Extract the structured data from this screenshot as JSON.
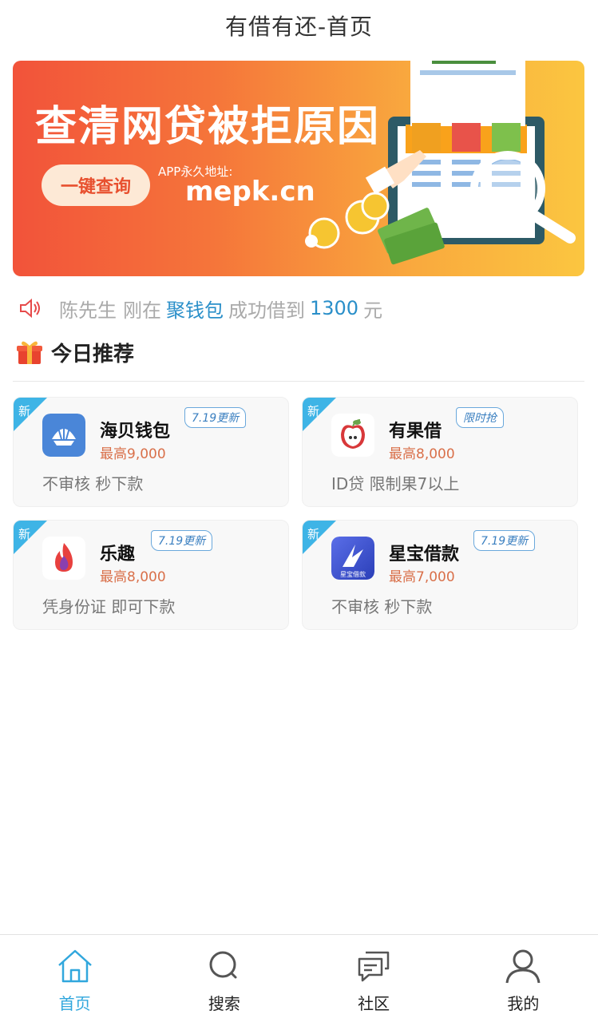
{
  "header": {
    "title": "有借有还-首页"
  },
  "banner": {
    "headline": "查清网贷被拒原因",
    "button_label": "一键查询",
    "app_label": "APP永久地址:",
    "url": "mepk.cn"
  },
  "notice": {
    "icon": "speaker-icon",
    "user": "陈先生",
    "verb": "刚在",
    "product": "聚钱包",
    "action": "成功借到",
    "amount": "1300",
    "unit": "元"
  },
  "section": {
    "icon": "gift-icon",
    "title": "今日推荐"
  },
  "cards": [
    {
      "tag": "新",
      "name": "海贝钱包",
      "badge": "7.19更新",
      "amount": "最高9,000",
      "desc": "不审核 秒下款",
      "logo": "shell-icon"
    },
    {
      "tag": "新",
      "name": "有果借",
      "badge": "限时抢",
      "amount": "最高8,000",
      "desc": "ID贷 限制果7以上",
      "logo": "apple-icon"
    },
    {
      "tag": "新",
      "name": "乐趣",
      "badge": "7.19更新",
      "amount": "最高8,000",
      "desc": "凭身份证 即可下款",
      "logo": "flame-icon"
    },
    {
      "tag": "新",
      "name": "星宝借款",
      "badge": "7.19更新",
      "amount": "最高7,000",
      "desc": "不审核 秒下款",
      "logo": "star-logo-icon",
      "logo_text": "星宝借款"
    }
  ],
  "tabbar": {
    "items": [
      {
        "label": "首页",
        "icon": "home-icon",
        "active": true
      },
      {
        "label": "搜索",
        "icon": "search-icon",
        "active": false
      },
      {
        "label": "社区",
        "icon": "chat-icon",
        "active": false
      },
      {
        "label": "我的",
        "icon": "user-icon",
        "active": false
      }
    ]
  },
  "colors": {
    "accent": "#31a7dd",
    "amount": "#d9704a",
    "banner_start": "#f2533a",
    "banner_end": "#fbc640"
  }
}
